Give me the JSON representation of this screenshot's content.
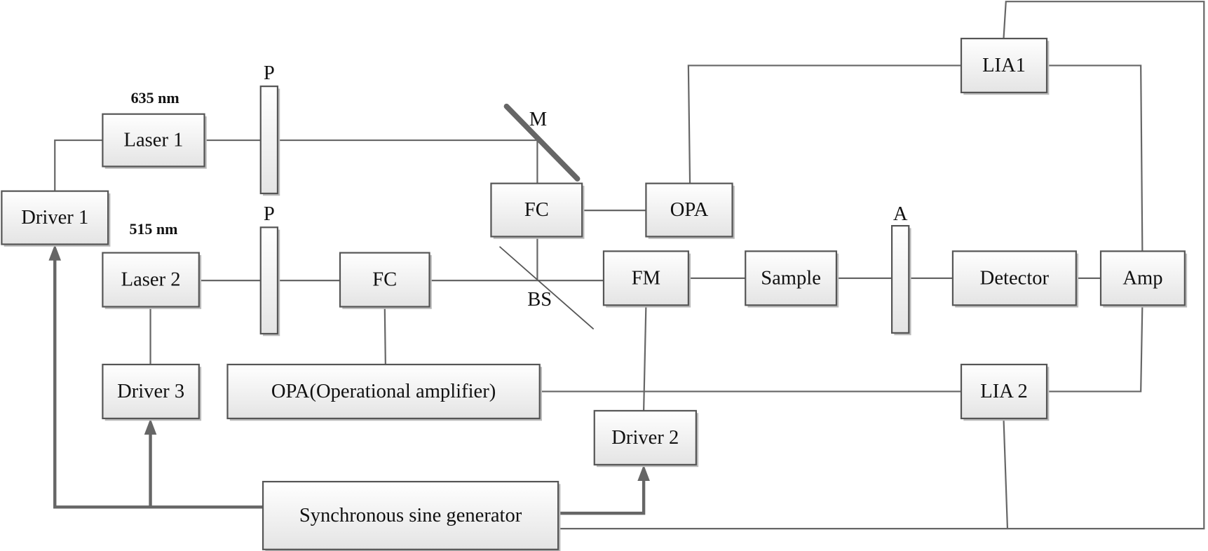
{
  "components": {
    "laser1": "Laser 1",
    "laser2": "Laser 2",
    "driver1": "Driver 1",
    "driver2": "Driver 2",
    "driver3": "Driver 3",
    "fc_upper": "FC",
    "fc_lower": "FC",
    "opa": "OPA",
    "opa_full": "OPA(Operational amplifier)",
    "fm": "FM",
    "sample": "Sample",
    "detector": "Detector",
    "amp": "Amp",
    "lia1": "LIA1",
    "lia2": "LIA 2",
    "sine_gen": "Synchronous sine generator"
  },
  "labels": {
    "wavelength1": "635 nm",
    "wavelength2": "515 nm",
    "polarizer_upper": "P",
    "polarizer_lower": "P",
    "analyzer": "A",
    "mirror": "M",
    "beam_splitter": "BS"
  }
}
